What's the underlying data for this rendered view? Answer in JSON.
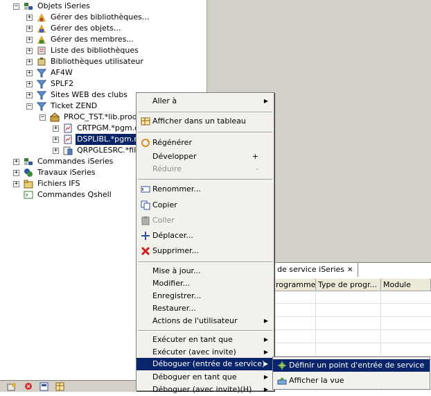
{
  "tree": {
    "items": [
      {
        "label": "Objets iSeries",
        "expander": "−"
      },
      {
        "label": "Gérer des bibliothèques...",
        "expander": "+"
      },
      {
        "label": "Gérer des objets...",
        "expander": "+"
      },
      {
        "label": "Gérer des membres...",
        "expander": "+"
      },
      {
        "label": "Liste des bibliothèques",
        "expander": "+"
      },
      {
        "label": "Bibliothèques utilisateur",
        "expander": "+"
      },
      {
        "label": "AF4W",
        "expander": "+"
      },
      {
        "label": "SPLF2",
        "expander": "+"
      },
      {
        "label": "Sites WEB des clubs",
        "expander": "+"
      },
      {
        "label": "Ticket ZEND",
        "expander": "−"
      },
      {
        "label": "PROC_TST.*lib.prod",
        "expander": "−"
      },
      {
        "label": "CRTPGM.*pgm.clp",
        "expander": "+"
      },
      {
        "label": "DSPLIBL.*pgm.rpg",
        "expander": "+"
      },
      {
        "label": "QRPGLESRC.*file",
        "expander": "+"
      },
      {
        "label": "Commandes iSeries",
        "expander": "+"
      },
      {
        "label": "Travaux iSeries",
        "expander": "+"
      },
      {
        "label": "Fichiers IFS",
        "expander": "+"
      },
      {
        "label": "Commandes Qshell",
        "expander": ""
      }
    ]
  },
  "view": {
    "tab_label": "de service iSeries",
    "close_icon": "✕",
    "columns": [
      "rogramme",
      "Type de progr...",
      "Module"
    ]
  },
  "context_menu": {
    "items": [
      {
        "label": "Aller à",
        "icon": "",
        "submenu": true
      },
      {
        "label": "Afficher dans un tableau",
        "icon": "table-icon"
      },
      {
        "label": "Régénérer",
        "icon": "refresh-icon"
      },
      {
        "label": "Développer",
        "accel": "+"
      },
      {
        "label": "Réduire",
        "accel": "-",
        "disabled": true
      },
      {
        "label": "Renommer...",
        "icon": "rename-icon"
      },
      {
        "label": "Copier",
        "icon": "copy-icon"
      },
      {
        "label": "Coller",
        "icon": "paste-icon",
        "disabled": true
      },
      {
        "label": "Déplacer...",
        "icon": "move-icon"
      },
      {
        "label": "Supprimer...",
        "icon": "delete-icon"
      },
      {
        "label": "Mise à jour..."
      },
      {
        "label": "Modifier..."
      },
      {
        "label": "Enregistrer..."
      },
      {
        "label": "Restaurer..."
      },
      {
        "label": "Actions de l'utilisateur",
        "submenu": true
      },
      {
        "label": "Exécuter en tant que",
        "submenu": true
      },
      {
        "label": "Exécuter (avec invite)",
        "submenu": true
      },
      {
        "label": "Déboguer (entrée de service)",
        "submenu": true,
        "active": true
      },
      {
        "label": "Déboguer en tant que",
        "submenu": true
      },
      {
        "label": "Déboguer (avec invite)(H)",
        "submenu": true
      }
    ]
  },
  "submenu": {
    "items": [
      {
        "label": "Définir un point d'entrée de service",
        "icon": "service-entry-icon",
        "active": true
      },
      {
        "label": "Afficher la vue",
        "icon": "view-icon"
      }
    ]
  },
  "colors": {
    "selection": "#0a246a",
    "editor_gray": "#d4d0c8",
    "menu_bg": "#f3f1eb"
  }
}
